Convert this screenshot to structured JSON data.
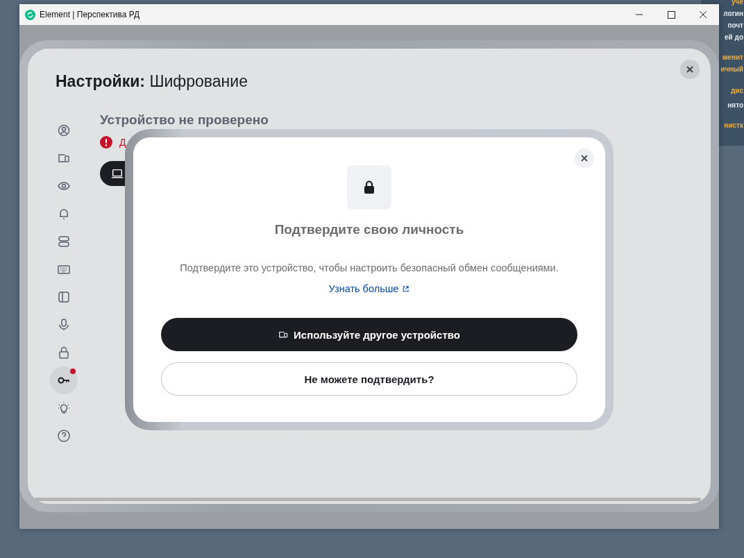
{
  "window": {
    "title": "Element | Перспектива РД"
  },
  "background_window": {
    "lines": [
      {
        "text": "уче",
        "kind": "accent"
      },
      {
        "text": "логин",
        "kind": "plain"
      },
      {
        "text": "почт",
        "kind": "plain"
      },
      {
        "text": "ей до",
        "kind": "plain"
      },
      {
        "text": "менит",
        "kind": "accent"
      },
      {
        "text": "ичный",
        "kind": "accent"
      },
      {
        "text": "дис",
        "kind": "accent"
      },
      {
        "text": "нято",
        "kind": "plain"
      },
      {
        "text": "нистк",
        "kind": "accent"
      }
    ]
  },
  "settings": {
    "title": "**Настройки:** Шифрование",
    "sidebar": {
      "items": [
        {
          "selected": false,
          "alert": false
        },
        {
          "selected": false,
          "alert": false
        },
        {
          "selected": false,
          "alert": false
        },
        {
          "selected": false,
          "alert": false
        },
        {
          "selected": false,
          "alert": false
        },
        {
          "selected": false,
          "alert": false
        },
        {
          "selected": false,
          "alert": false
        },
        {
          "selected": false,
          "alert": false
        },
        {
          "selected": false,
          "alert": false
        },
        {
          "selected": true,
          "alert": true
        },
        {
          "selected": false,
          "alert": false
        },
        {
          "selected": false,
          "alert": false
        }
      ]
    },
    "section_title": "Устройство не проверено",
    "warning": "Д"
  },
  "dialog": {
    "title": "Подтвердите свою личность",
    "text": "Подтвердите это устройство, чтобы настроить безопасный обмен сообщениями.",
    "link": "Узнать больше",
    "buttons": [
      {
        "label": "Используйте другое устройство",
        "kind": "primary"
      },
      {
        "label": "Не можете подтвердить?",
        "kind": "secondary"
      }
    ]
  }
}
